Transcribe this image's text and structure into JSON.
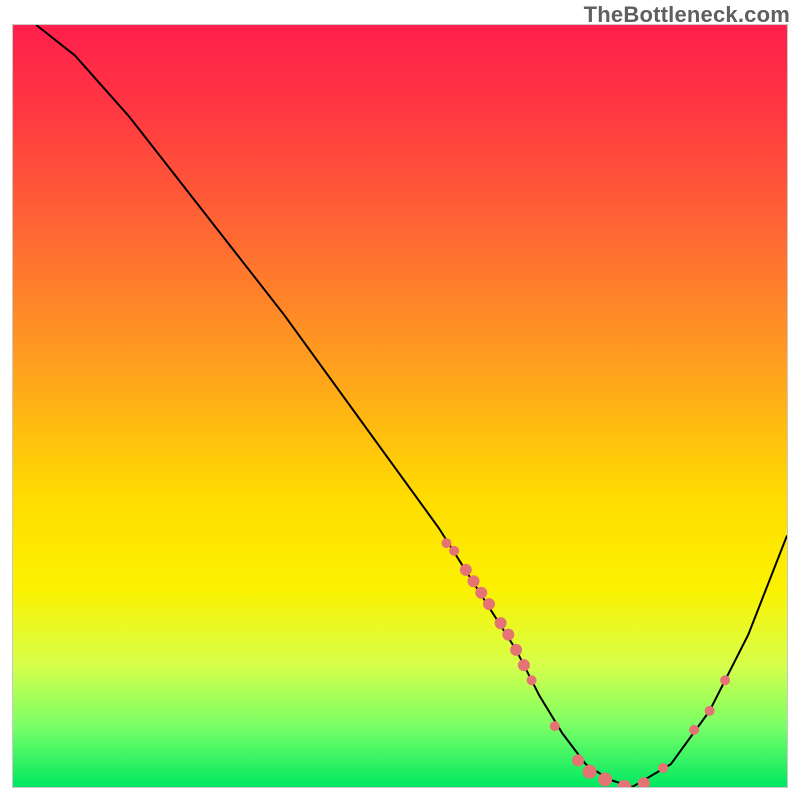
{
  "watermark": "TheBottleneck.com",
  "colors": {
    "curve": "#000000",
    "marker": "#e57373",
    "border": "#c9c9c9"
  },
  "chart_data": {
    "type": "line",
    "title": "",
    "xlabel": "",
    "ylabel": "",
    "xlim": [
      0,
      100
    ],
    "ylim": [
      0,
      100
    ],
    "curve": {
      "x": [
        3,
        8,
        15,
        25,
        35,
        45,
        55,
        60,
        65,
        68,
        71,
        74,
        77,
        80,
        85,
        90,
        95,
        100
      ],
      "y": [
        100,
        96,
        88,
        75,
        62,
        48,
        34,
        26,
        18,
        12,
        7,
        3,
        1,
        0,
        3,
        10,
        20,
        33
      ]
    },
    "markers": [
      {
        "x": 56,
        "y": 32,
        "r": 5
      },
      {
        "x": 57,
        "y": 31,
        "r": 5
      },
      {
        "x": 58.5,
        "y": 28.5,
        "r": 6
      },
      {
        "x": 59.5,
        "y": 27,
        "r": 6
      },
      {
        "x": 60.5,
        "y": 25.5,
        "r": 6
      },
      {
        "x": 61.5,
        "y": 24,
        "r": 6
      },
      {
        "x": 63,
        "y": 21.5,
        "r": 6
      },
      {
        "x": 64,
        "y": 20,
        "r": 6
      },
      {
        "x": 65,
        "y": 18,
        "r": 6
      },
      {
        "x": 66,
        "y": 16,
        "r": 6
      },
      {
        "x": 67,
        "y": 14,
        "r": 5
      },
      {
        "x": 70,
        "y": 8,
        "r": 5
      },
      {
        "x": 73,
        "y": 3.5,
        "r": 6
      },
      {
        "x": 74.5,
        "y": 2,
        "r": 7
      },
      {
        "x": 76.5,
        "y": 1,
        "r": 7
      },
      {
        "x": 79,
        "y": 0,
        "r": 7
      },
      {
        "x": 81.5,
        "y": 0.5,
        "r": 6
      },
      {
        "x": 84,
        "y": 2.5,
        "r": 5
      },
      {
        "x": 88,
        "y": 7.5,
        "r": 5
      },
      {
        "x": 90,
        "y": 10,
        "r": 5
      },
      {
        "x": 92,
        "y": 14,
        "r": 5
      }
    ]
  }
}
